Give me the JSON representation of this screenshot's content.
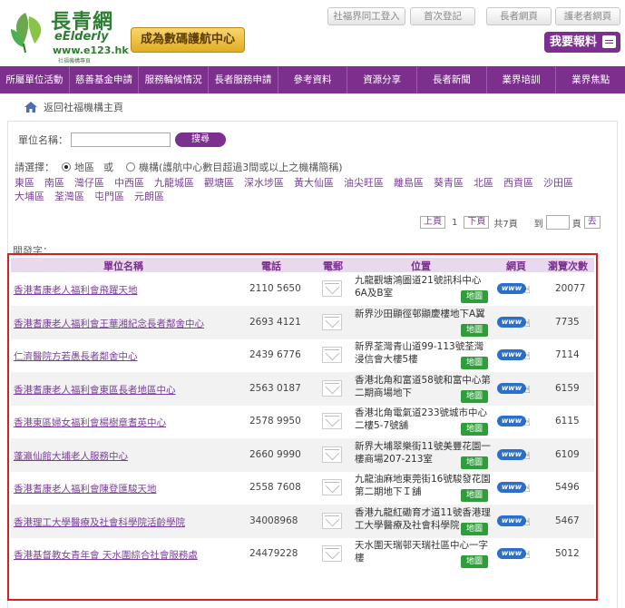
{
  "logo": {
    "title": "長青網",
    "subtitle": "eElderly",
    "url": "www.e123.hk",
    "tagline": "社福機構專頁"
  },
  "header": {
    "ambassador": "成為數碼護航中心",
    "links": [
      "社福界同工登入",
      "首次登記",
      "長者網頁",
      "護老者網頁"
    ],
    "report": "我要報料"
  },
  "nav": [
    "所屬單位活動",
    "慈善基金申請",
    "服務輪候情況",
    "長者服務申請",
    "參考資料",
    "資源分享",
    "長者新聞",
    "業界培訓",
    "業界焦點"
  ],
  "breadcrumb": "返回社福機構主頁",
  "search": {
    "label": "單位名稱：",
    "button": "搜尋"
  },
  "select": {
    "label": "請選擇：",
    "opt1": "地區",
    "or": "或",
    "opt2": "機構",
    "note": "(護航中心數目超過3間或以上之機構簡稱)"
  },
  "districts": [
    "東區",
    "南區",
    "灣仔區",
    "中西區",
    "九龍城區",
    "觀塘區",
    "深水埗區",
    "黃大仙區",
    "油尖旺區",
    "離島區",
    "葵青區",
    "北區",
    "西貢區",
    "沙田區",
    "大埔區",
    "荃灣區",
    "屯門區",
    "元朗區"
  ],
  "pager": {
    "prev": "上頁",
    "current": "1",
    "next": "下頁",
    "total": "共7頁",
    "goto": "到",
    "unit": "頁",
    "go": "去"
  },
  "sort_label": "開發字：",
  "table": {
    "headers": {
      "name": "單位名稱",
      "phone": "電話",
      "email": "電郵",
      "location": "位置",
      "web": "網頁",
      "views": "瀏覽次數"
    },
    "map_label": "地圖",
    "web_label": "www",
    "rows": [
      {
        "name": "香港耆康老人福利會飛躍天地",
        "phone": "2110 5650",
        "address": "九龍觀塘鴻圖道21號訊科中心6A及B室",
        "views": "20077"
      },
      {
        "name": "香港耆康老人福利會王華湘紀念長者鄰舍中心",
        "phone": "2693 4121",
        "address": "新界沙田顯徑邨顯慶樓地下A翼",
        "views": "7735"
      },
      {
        "name": "仁濟醫院方若愚長者鄰舍中心",
        "phone": "2439 6776",
        "address": "新界荃灣青山道99-113號荃灣浸信會大樓5樓",
        "views": "7114"
      },
      {
        "name": "香港耆康老人福利會東區長者地區中心",
        "phone": "2563 0187",
        "address": "香港北角和富道58號和富中心第二期商場地下",
        "views": "6159"
      },
      {
        "name": "香港東區婦女福利會楊樹章耆英中心",
        "phone": "2578 9950",
        "address": "香港北角電氣道233號城市中心二樓5-7號舖",
        "views": "6115"
      },
      {
        "name": "蓬瀛仙館大埔老人服務中心",
        "phone": "2660 9990",
        "address": "新界大埔翠樂街11號美豐花園一樓商場207-213室",
        "views": "6109"
      },
      {
        "name": "香港耆康老人福利會陳登匯駿天地",
        "phone": "2558 7608",
        "address": "九龍油麻地東莞街16號駿發花園第二期地下Ｉ舖",
        "views": "5496"
      },
      {
        "name": "香港理工大學醫療及社會科學院活齡學院",
        "phone": "34008968",
        "address": "香港九龍紅磡育才道11號香港理工大學醫療及社會科學院",
        "views": "5467"
      },
      {
        "name": "香港基督教女青年會 天水圍綜合社會服務處",
        "phone": "24479228",
        "address": "天水圍天瑞邨天瑞社區中心一字樓",
        "views": "5012"
      }
    ]
  }
}
